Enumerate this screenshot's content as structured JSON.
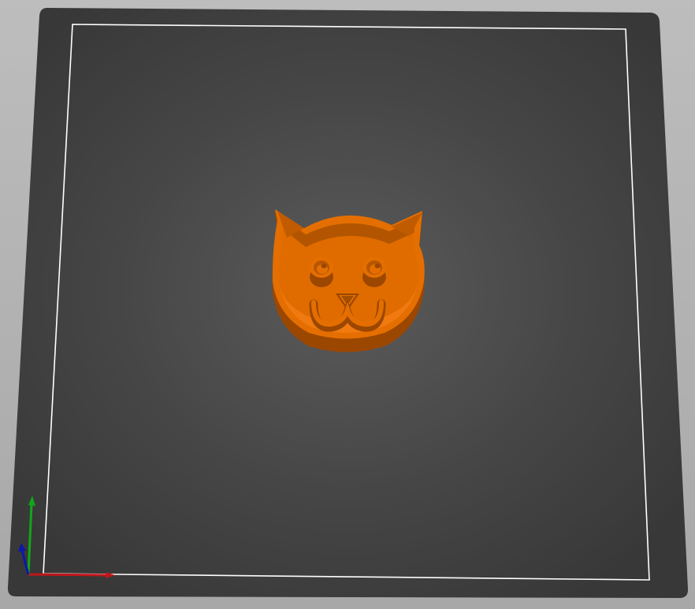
{
  "viewport": {
    "background": "#b3b3b3",
    "bed_color": "#3a3a3a",
    "bed_center_color": "#5a5a5a",
    "bed_border_color": "#ffffff"
  },
  "model": {
    "shape": "cat-face-cookie-cutter",
    "color": "#e46f00",
    "shade_color": "#a44e00",
    "edge_color": "#f08a1a"
  },
  "axes": {
    "x_color": "#c0161a",
    "y_color": "#11a61a",
    "z_color": "#0c18a8"
  }
}
